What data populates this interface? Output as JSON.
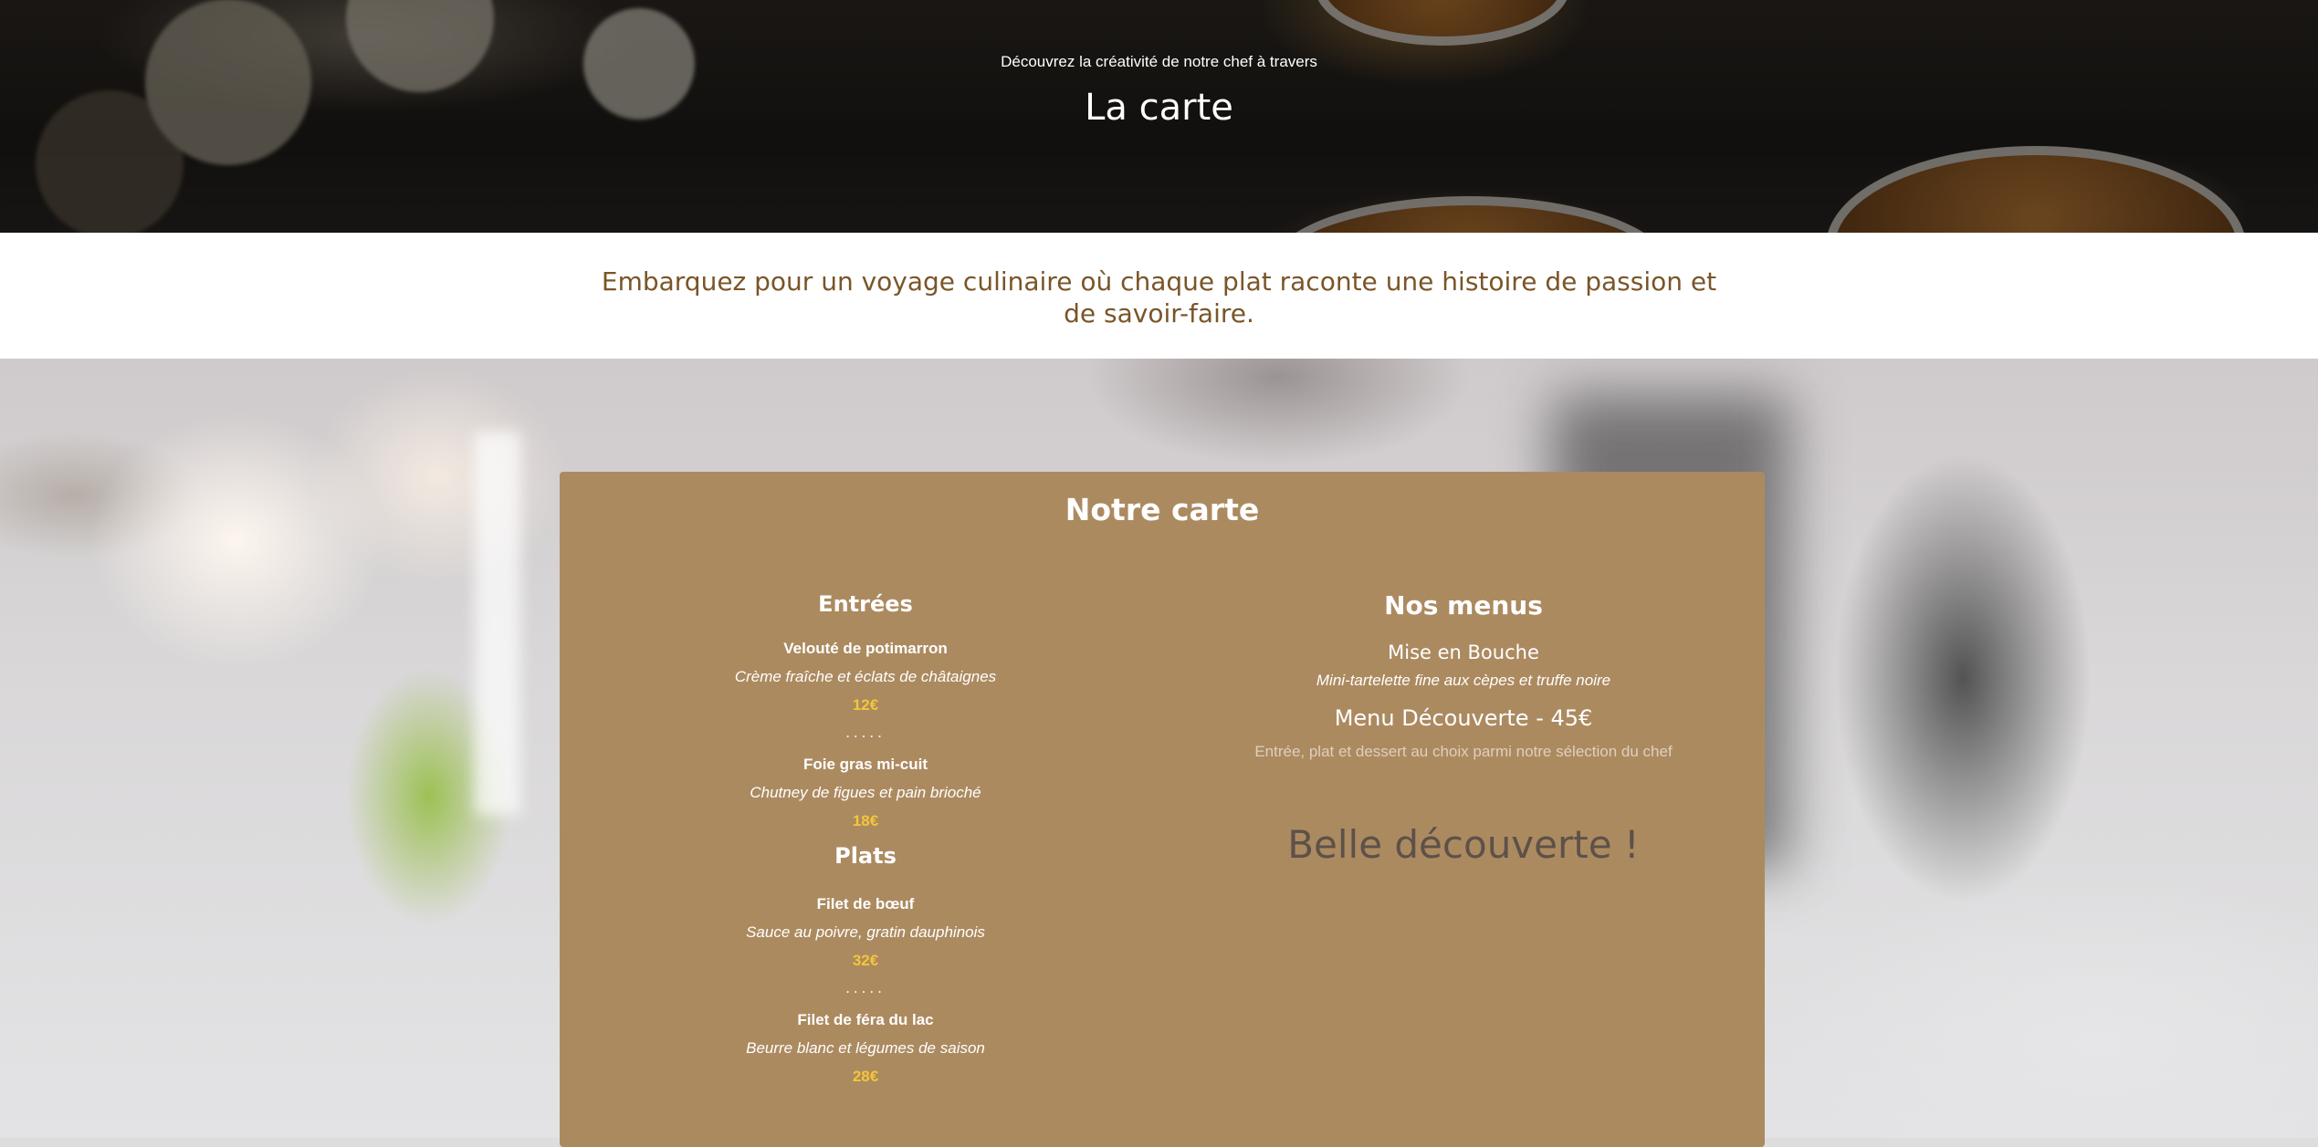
{
  "hero": {
    "subtitle": "Découvrez la créativité de notre chef à travers",
    "title": "La carte"
  },
  "intro": {
    "text": "Embarquez pour un voyage culinaire où chaque plat raconte une histoire de passion et de savoir-faire."
  },
  "menu_card": {
    "title": "Notre carte",
    "separator": ".....",
    "entrees": {
      "title": "Entrées",
      "dishes": [
        {
          "name": "Velouté de potimarron",
          "description": "Crème fraîche et éclats de châtaignes",
          "price": "12€"
        },
        {
          "name": "Foie gras mi-cuit",
          "description": "Chutney de figues et pain brioché",
          "price": "18€"
        }
      ]
    },
    "plats": {
      "title": "Plats",
      "dishes": [
        {
          "name": "Filet de bœuf",
          "description": "Sauce au poivre, gratin dauphinois",
          "price": "32€"
        },
        {
          "name": "Filet de féra du lac",
          "description": "Beurre blanc et légumes de saison",
          "price": "28€"
        }
      ]
    },
    "menus": {
      "title": "Nos menus",
      "items": [
        {
          "name": "Mise en Bouche",
          "description": "Mini-tartelette fine aux cèpes et truffe noire"
        },
        {
          "name": "Menu Découverte - 45€",
          "description": "Entrée, plat et dessert au choix parmi notre sélection du chef"
        }
      ]
    },
    "closing": "Belle découverte !"
  },
  "colors": {
    "panel": "#ac8a60",
    "price": "#f3c63a",
    "intro_text": "#7a5528",
    "closing": "#5d5149"
  }
}
